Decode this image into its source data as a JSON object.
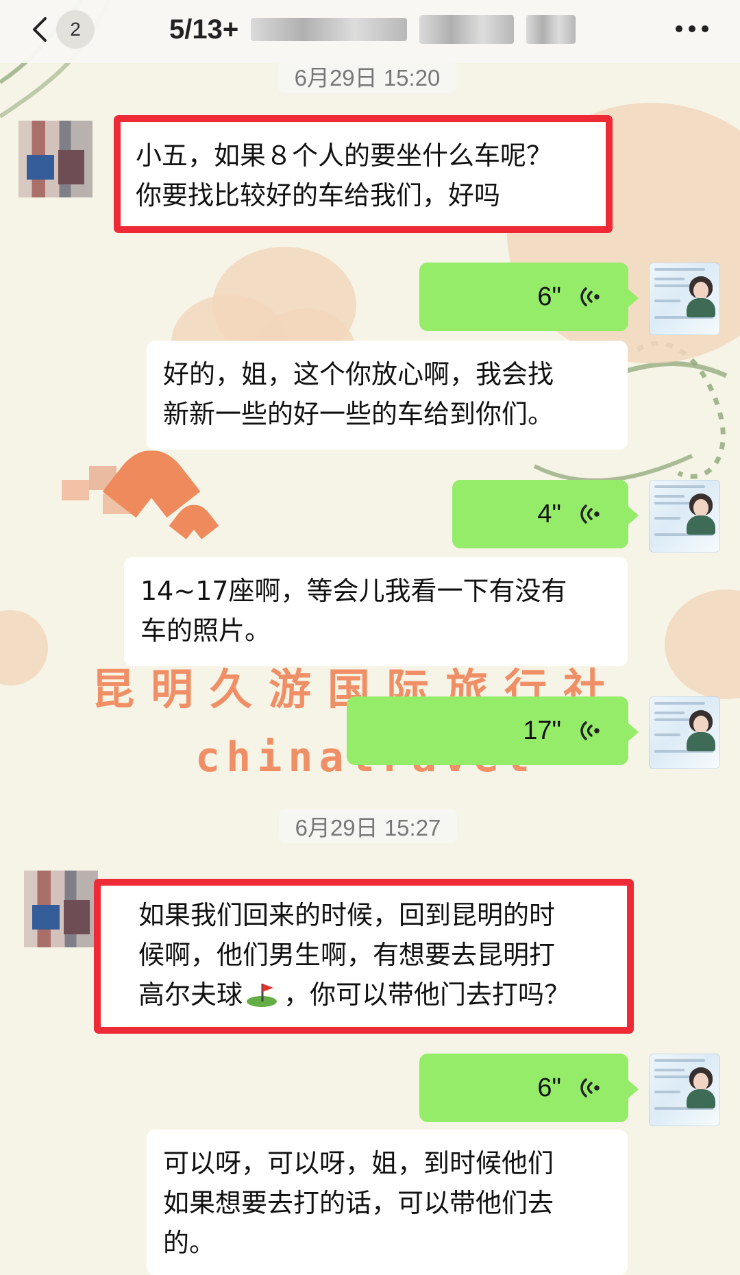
{
  "header": {
    "back_count": "2",
    "title_prefix": "5/13+"
  },
  "timestamps": [
    "6月29日 15:20",
    "6月29日 15:27"
  ],
  "messages": [
    {
      "side": "left",
      "type": "text",
      "highlighted": true,
      "lines": [
        "小五，如果８个人的要坐什么车呢？",
        "你要找比较好的车给我们，好吗"
      ]
    },
    {
      "side": "right",
      "type": "voice",
      "duration": "6\""
    },
    {
      "side": "right",
      "type": "text",
      "lines": [
        "好的，姐，这个你放心啊，我会找",
        "新新一些的好一些的车给到你们。"
      ]
    },
    {
      "side": "right",
      "type": "voice",
      "duration": "4\""
    },
    {
      "side": "right",
      "type": "text",
      "lines": [
        "14~17座啊，等会儿我看一下有没有",
        "车的照片。"
      ]
    },
    {
      "side": "right",
      "type": "voice",
      "duration": "17\""
    },
    {
      "side": "left",
      "type": "text",
      "highlighted": true,
      "lines": [
        "如果我们回来的时候，回到昆明的时",
        "候啊，他们男生啊，有想要去昆明打",
        "高尔夫球",
        "，你可以带他门去打吗？"
      ]
    },
    {
      "side": "right",
      "type": "voice",
      "duration": "6\""
    },
    {
      "side": "right",
      "type": "text",
      "lines": [
        "可以呀，可以呀，姐，到时候他们",
        "如果想要去打的话，可以带他们去",
        "的。"
      ]
    }
  ],
  "background": {
    "watermark_cn": "昆明久游国际旅行社",
    "watermark_en": "chinatravel"
  },
  "colors": {
    "chat_background": "#f6f4e6",
    "voice_bubble": "#95ec69",
    "highlight_border": "#ed2a36",
    "timestamp_text": "#777777"
  },
  "icons": {
    "back": "chevron-left-icon",
    "more": "more-dots-icon",
    "voice": "voice-wave-icon",
    "golf_emoji": "golf-flag-icon"
  }
}
